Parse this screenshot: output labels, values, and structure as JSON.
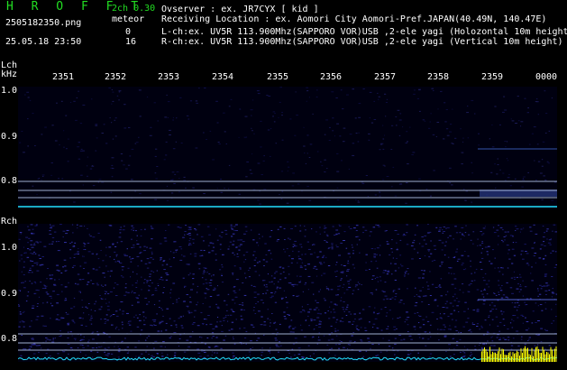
{
  "header": {
    "app_title": "H R O F F T",
    "version": "2ch 0.30",
    "filename": "2505182350.png",
    "meteor_label": "meteor",
    "count_l": "0",
    "count_r": "16",
    "datetime": "25.05.18 23:50",
    "observer": "Ovserver           : ex. JR7CYX [ kid ]",
    "location": "Receiving Location : ex. Aomori City Aomori-Pref.JAPAN(40.49N, 140.47E)",
    "lch": "L-ch:ex. UV5R 113.900Mhz(SAPPORO VOR)USB ,2-ele yagi (Holozontal 10m height",
    "rch": "R-ch:ex. UV5R 113.900Mhz(SAPPORO VOR)USB ,2-ele yagi (Vertical 10m height)"
  },
  "axes": {
    "lch_label": "Lch",
    "khz_label": "kHz",
    "rch_label": "Rch",
    "x_ticks": [
      "2351",
      "2352",
      "2353",
      "2354",
      "2355",
      "2356",
      "2357",
      "2358",
      "2359",
      "0000"
    ],
    "y_ticks_l": [
      "1.0",
      "0.9",
      "0.8"
    ],
    "y_ticks_r": [
      "1.0",
      "0.9",
      "0.8"
    ]
  },
  "colors": {
    "title_green": "#22dd22",
    "trace_cyan": "#22e0ff",
    "burst_yellow": "#ffff00",
    "grid_line": "#9fb0d0"
  }
}
